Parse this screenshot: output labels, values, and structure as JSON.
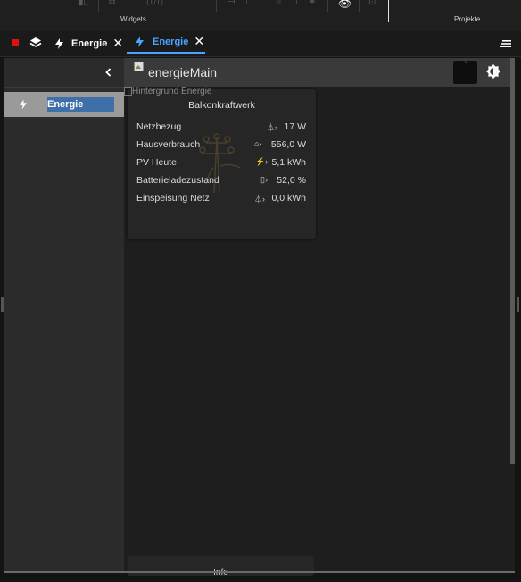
{
  "toolbar": {
    "section1_label": "Widgets",
    "section2_label": "Projekte",
    "counter_text": "(1/1)"
  },
  "tabs": [
    {
      "label": "Energie",
      "active": false
    },
    {
      "label": "Energie",
      "active": true
    }
  ],
  "sidebar": {
    "back_icon": "chevron-left-icon",
    "items": [
      {
        "label": "Energie",
        "icon": "bolt-icon"
      }
    ]
  },
  "view": {
    "title": "energieMain",
    "badge": "`",
    "background_alt": "Hintergrund Energie"
  },
  "card": {
    "title": "Balkonkraftwerk",
    "rows": [
      {
        "label": "Netzbezug",
        "value": "17 W",
        "icon": "tower-import-icon"
      },
      {
        "label": "Hausverbrauch",
        "value": "556,0 W",
        "icon": "house-icon"
      },
      {
        "label": "PV Heute",
        "value": "5,1 kWh",
        "icon": "solar-icon"
      },
      {
        "label": "Batterieladezustand",
        "value": "52,0 %",
        "icon": "battery-icon"
      },
      {
        "label": "Einspeisung Netz",
        "value": "0,0 kWh",
        "icon": "tower-export-icon"
      }
    ]
  },
  "card2": {
    "title": "Info"
  },
  "colors": {
    "accent": "#4aa3ff",
    "record": "#e01010",
    "selection": "#3f6fa8"
  }
}
